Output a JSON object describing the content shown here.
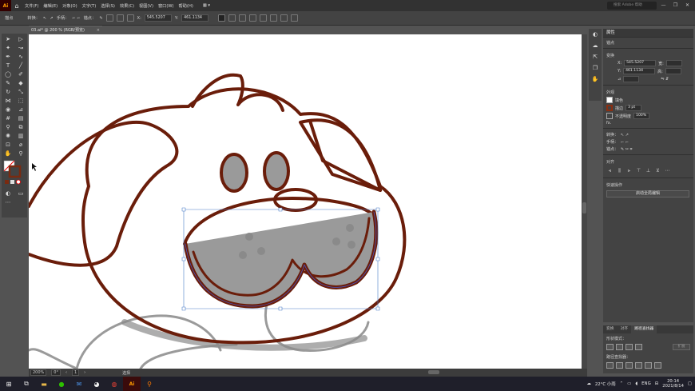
{
  "app": {
    "logo": "Ai",
    "home_icon": "home-icon"
  },
  "menu": [
    "文件(F)",
    "编辑(E)",
    "对象(O)",
    "文字(T)",
    "选择(S)",
    "效果(C)",
    "视图(V)",
    "窗口(W)",
    "帮助(H)"
  ],
  "search": {
    "placeholder": "搜索 Adobe 帮助"
  },
  "control": {
    "selection_label": "描点",
    "convert_label": "转换：",
    "handles_label": "手柄：",
    "anchor_label": "锚点：",
    "x_label": "X:",
    "x_value": "545.5207",
    "y_label": "Y:",
    "y_value": "461.1134"
  },
  "document": {
    "tab_title": "03.ai* @ 200 % (RGB/预览)",
    "close": "×"
  },
  "status": {
    "zoom": "200%",
    "angle": "0°",
    "artboard": "1",
    "tool": "选择"
  },
  "properties": {
    "title": "属性",
    "section_anchor": "锚点",
    "section_transform": "变换",
    "x_label": "X:",
    "x_value": "545.5207",
    "y_label": "Y:",
    "y_value": "461.1134",
    "w_label": "宽:",
    "h_label": "高:",
    "section_appearance": "外观",
    "fill_label": "填色",
    "stroke_label": "描边",
    "stroke_value": "3 pt",
    "opacity_label": "不透明度",
    "opacity_value": "100%",
    "fx_label": "fx.",
    "convert_label": "转换：",
    "handles_label": "手柄：",
    "anchor_label": "锚点：",
    "section_align": "对齐",
    "section_quick": "快速操作",
    "global_edit_button": "启动全局编辑"
  },
  "pathfinder": {
    "tabs": [
      "变换",
      "对齐",
      "路径查找器"
    ],
    "shape_modes_label": "形状模式：",
    "expand_button": "扩展",
    "pathfinder_label": "路径查找器："
  },
  "taskbar": {
    "weather": "22°C 小雨",
    "lang": "ENG",
    "time": "20:14",
    "date": "2021/8/14"
  }
}
